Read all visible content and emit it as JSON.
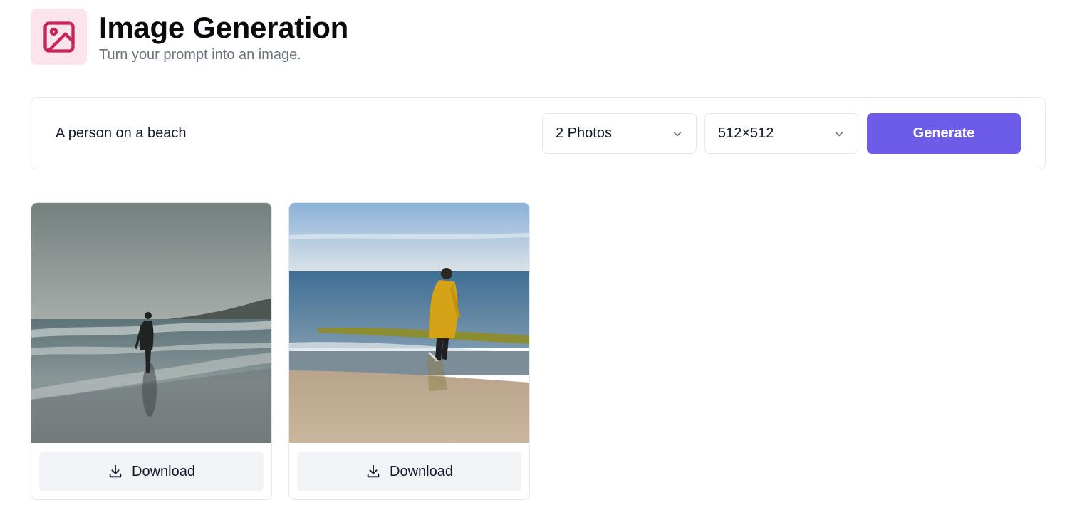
{
  "header": {
    "title": "Image Generation",
    "subtitle": "Turn your prompt into an image.",
    "icon": "image-icon",
    "icon_color": "#c8235b",
    "icon_bg": "#fbe4ec"
  },
  "prompt_bar": {
    "prompt_value": "A person on a beach",
    "photo_count": {
      "selected": "2 Photos",
      "icon": "chevron-down-icon"
    },
    "resolution": {
      "selected": "512×512",
      "icon": "chevron-down-icon"
    },
    "generate_label": "Generate",
    "accent_color": "#6c5ce7"
  },
  "results": [
    {
      "download_label": "Download",
      "icon": "download-icon"
    },
    {
      "download_label": "Download",
      "icon": "download-icon"
    }
  ]
}
